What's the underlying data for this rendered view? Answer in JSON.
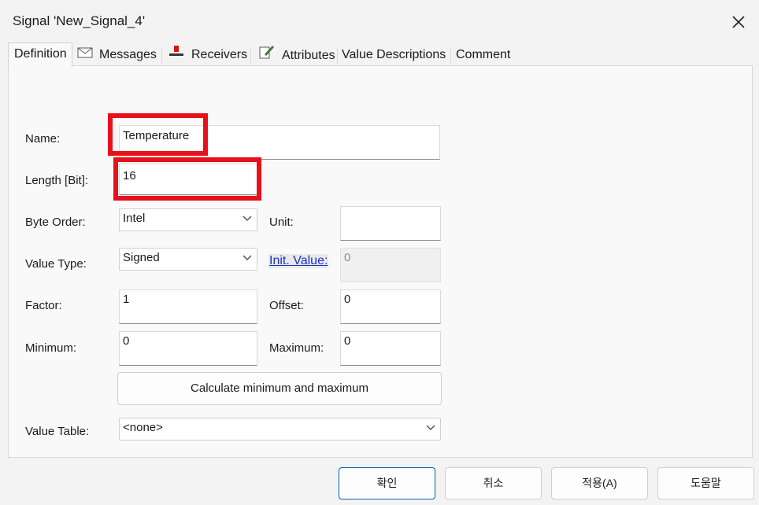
{
  "window": {
    "title": "Signal 'New_Signal_4'"
  },
  "tabs": [
    {
      "label": "Definition",
      "icon": "none"
    },
    {
      "label": "Messages",
      "icon": "envelope-icon"
    },
    {
      "label": "Receivers",
      "icon": "receiver-icon"
    },
    {
      "label": "Attributes",
      "icon": "pencil-note-icon"
    },
    {
      "label": "Value Descriptions",
      "icon": "none"
    },
    {
      "label": "Comment",
      "icon": "none"
    }
  ],
  "form": {
    "name_label": "Name:",
    "name_value": "Temperature",
    "length_label": "Length [Bit]:",
    "length_value": "16",
    "byte_order_label": "Byte Order:",
    "byte_order_value": "Intel",
    "unit_label": "Unit:",
    "unit_value": "",
    "value_type_label": "Value Type:",
    "value_type_value": "Signed",
    "init_value_label": "Init. Value:",
    "init_value_value": "0",
    "factor_label": "Factor:",
    "factor_value": "1",
    "offset_label": "Offset:",
    "offset_value": "0",
    "minimum_label": "Minimum:",
    "minimum_value": "0",
    "maximum_label": "Maximum:",
    "maximum_value": "0",
    "calc_button": "Calculate minimum and maximum",
    "value_table_label": "Value Table:",
    "value_table_value": "<none>"
  },
  "footer": {
    "ok": "확인",
    "cancel": "취소",
    "apply": "적용(A)",
    "help": "도움말"
  },
  "colors": {
    "highlight": "#e8101a",
    "link": "#1533c4",
    "default_button_border": "#005fb8"
  }
}
